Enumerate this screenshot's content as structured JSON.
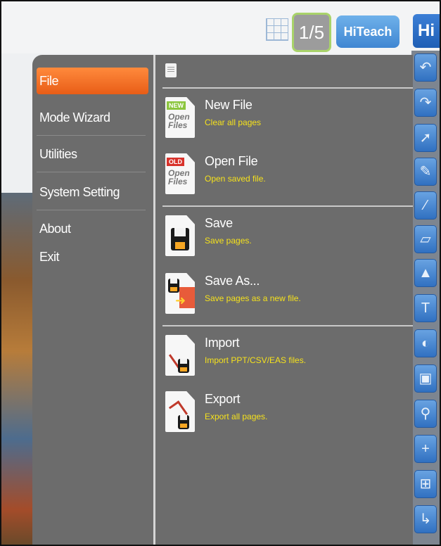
{
  "topbar": {
    "page_counter": "1/5",
    "hiteach_label": "HiTeach",
    "hi_label": "Hi",
    "grid_icon": "grid-icon"
  },
  "left_menu": {
    "items": [
      {
        "label": "File",
        "active": true
      },
      {
        "label": "Mode Wizard",
        "active": false
      },
      {
        "label": "Utilities",
        "active": false
      },
      {
        "label": "System Setting",
        "active": false
      },
      {
        "label": "About",
        "active": false
      },
      {
        "label": "Exit",
        "active": false
      }
    ]
  },
  "file_menu": {
    "items": [
      {
        "title": "New File",
        "desc": "Clear all pages",
        "icon": "new-file-icon",
        "tag": "NEW",
        "icon_text": "Open Files"
      },
      {
        "title": "Open File",
        "desc": "Open saved file.",
        "icon": "open-file-icon",
        "tag": "OLD",
        "icon_text": "Open Files"
      },
      {
        "title": "Save",
        "desc": "Save pages.",
        "icon": "save-icon"
      },
      {
        "title": "Save As...",
        "desc": "Save pages as a new file.",
        "icon": "save-as-icon"
      },
      {
        "title": "Import",
        "desc": "Import PPT/CSV/EAS files.",
        "icon": "import-icon"
      },
      {
        "title": "Export",
        "desc": "Export all pages.",
        "icon": "export-icon"
      }
    ]
  },
  "tool_rail": {
    "tools": [
      {
        "icon": "undo-icon",
        "glyph": "↶"
      },
      {
        "icon": "redo-icon",
        "glyph": "↷"
      },
      {
        "icon": "pointer-icon",
        "glyph": "➚"
      },
      {
        "icon": "pen-icon",
        "glyph": "✎"
      },
      {
        "icon": "brush-icon",
        "glyph": "⁄"
      },
      {
        "icon": "eraser-icon",
        "glyph": "▱"
      },
      {
        "icon": "shapes-icon",
        "glyph": "▲"
      },
      {
        "icon": "text-icon",
        "glyph": "T"
      },
      {
        "icon": "fill-icon",
        "glyph": "◐"
      },
      {
        "icon": "capture-icon",
        "glyph": "▣"
      },
      {
        "icon": "zoom-icon",
        "glyph": "⚲"
      },
      {
        "icon": "add-page-icon",
        "glyph": "+"
      },
      {
        "icon": "insert-page-icon",
        "glyph": "⊞"
      },
      {
        "icon": "next-page-icon",
        "glyph": "↳"
      }
    ]
  },
  "colors": {
    "menu_bg": "#6c6c6c",
    "active_item": "#f07020",
    "desc_text": "#f5e11c",
    "tool_blue": "#3f86d2"
  }
}
